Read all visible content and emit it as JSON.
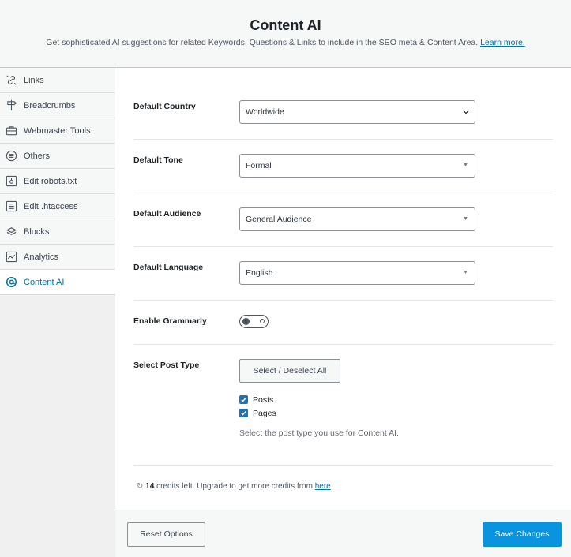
{
  "header": {
    "title": "Content AI",
    "description": "Get sophisticated AI suggestions for related Keywords, Questions & Links to include in the SEO meta & Content Area.",
    "learn_more": "Learn more."
  },
  "sidebar": {
    "items": [
      {
        "label": "Links",
        "icon": "links-icon"
      },
      {
        "label": "Breadcrumbs",
        "icon": "signpost-icon"
      },
      {
        "label": "Webmaster Tools",
        "icon": "toolbox-icon"
      },
      {
        "label": "Others",
        "icon": "list-circle-icon"
      },
      {
        "label": "Edit robots.txt",
        "icon": "file-icon"
      },
      {
        "label": "Edit .htaccess",
        "icon": "file-text-icon"
      },
      {
        "label": "Blocks",
        "icon": "blocks-icon"
      },
      {
        "label": "Analytics",
        "icon": "analytics-icon"
      },
      {
        "label": "Content AI",
        "icon": "content-ai-icon",
        "active": true
      }
    ]
  },
  "settings": {
    "country": {
      "label": "Default Country",
      "value": "Worldwide"
    },
    "tone": {
      "label": "Default Tone",
      "value": "Formal"
    },
    "audience": {
      "label": "Default Audience",
      "value": "General Audience"
    },
    "language": {
      "label": "Default Language",
      "value": "English"
    },
    "grammarly": {
      "label": "Enable Grammarly",
      "enabled": false
    },
    "post_type": {
      "label": "Select Post Type",
      "select_all": "Select / Deselect All",
      "options": [
        {
          "label": "Posts",
          "checked": true
        },
        {
          "label": "Pages",
          "checked": true
        }
      ],
      "description": "Select the post type you use for Content AI."
    }
  },
  "credits": {
    "count": "14",
    "text": "credits left. Upgrade to get more credits from",
    "link": "here",
    "suffix": "."
  },
  "footer": {
    "reset": "Reset Options",
    "save": "Save Changes"
  },
  "colors": {
    "accent": "#0a94e0",
    "link": "#0073aa",
    "checkbox": "#2271b1"
  }
}
